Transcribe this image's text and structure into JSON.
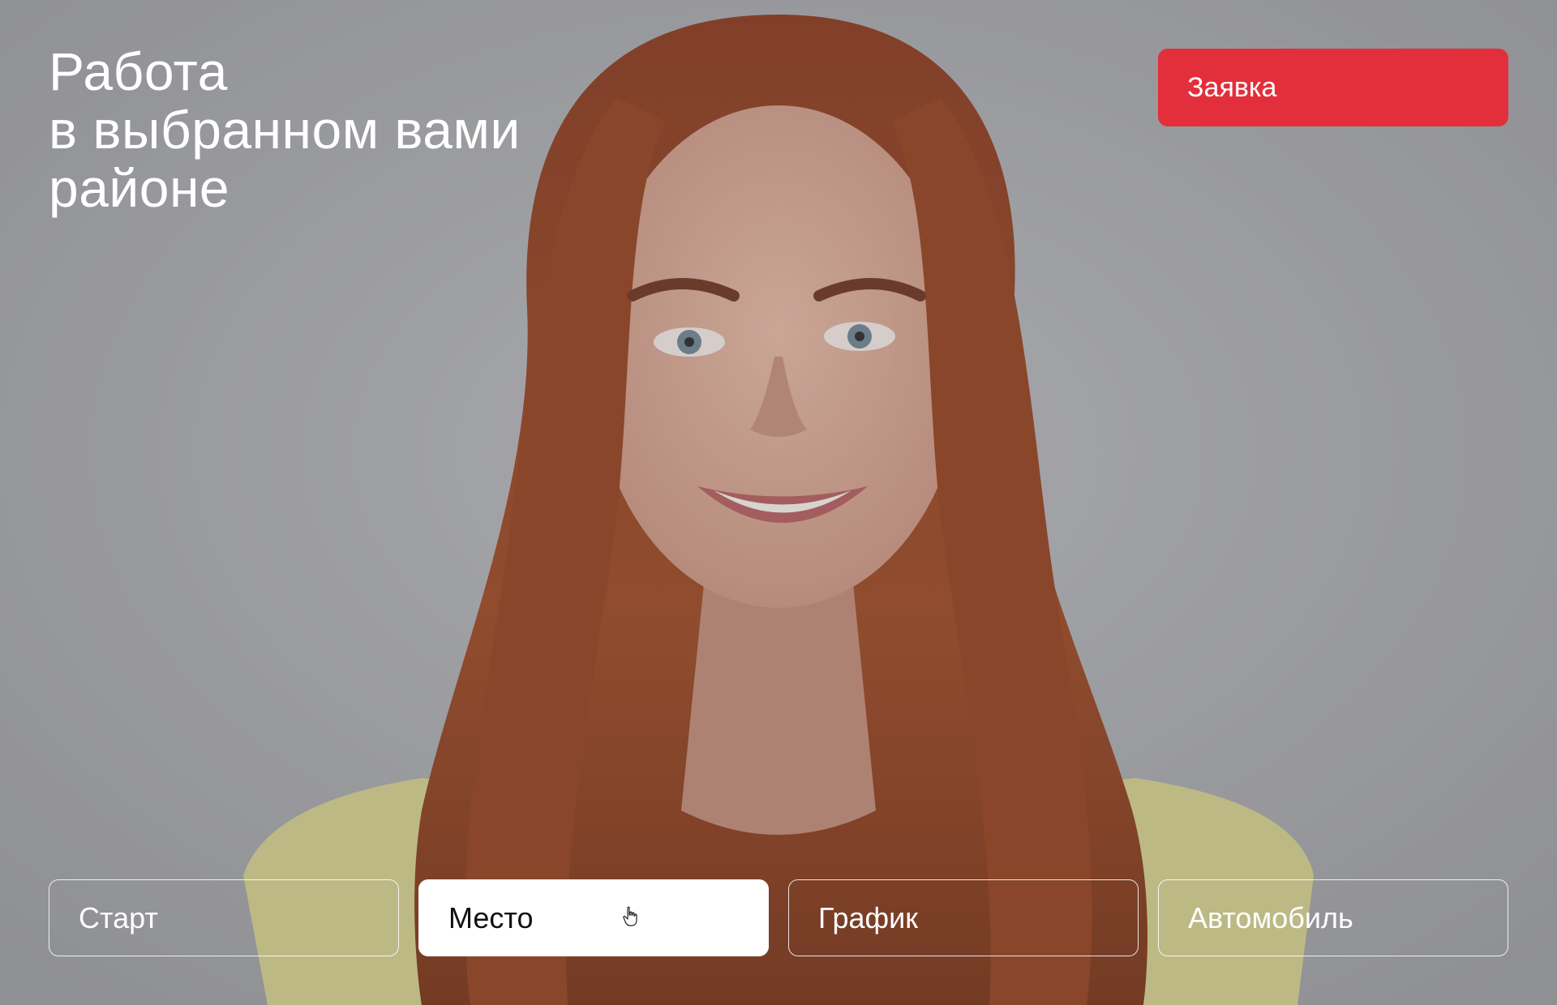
{
  "hero": {
    "headline": [
      "Работа",
      "в выбранном вами",
      "районе"
    ],
    "cta_label": "Заявка"
  },
  "tabs": [
    {
      "label": "Старт",
      "active": false
    },
    {
      "label": "Место",
      "active": true
    },
    {
      "label": "График",
      "active": false
    },
    {
      "label": "Автомобиль",
      "active": false
    }
  ],
  "colors": {
    "accent": "#e32f3b",
    "background": "#a4a5a7",
    "text_light": "#ffffff",
    "text_dark": "#111111"
  },
  "icons": {
    "cursor": "hand-pointer-icon"
  }
}
